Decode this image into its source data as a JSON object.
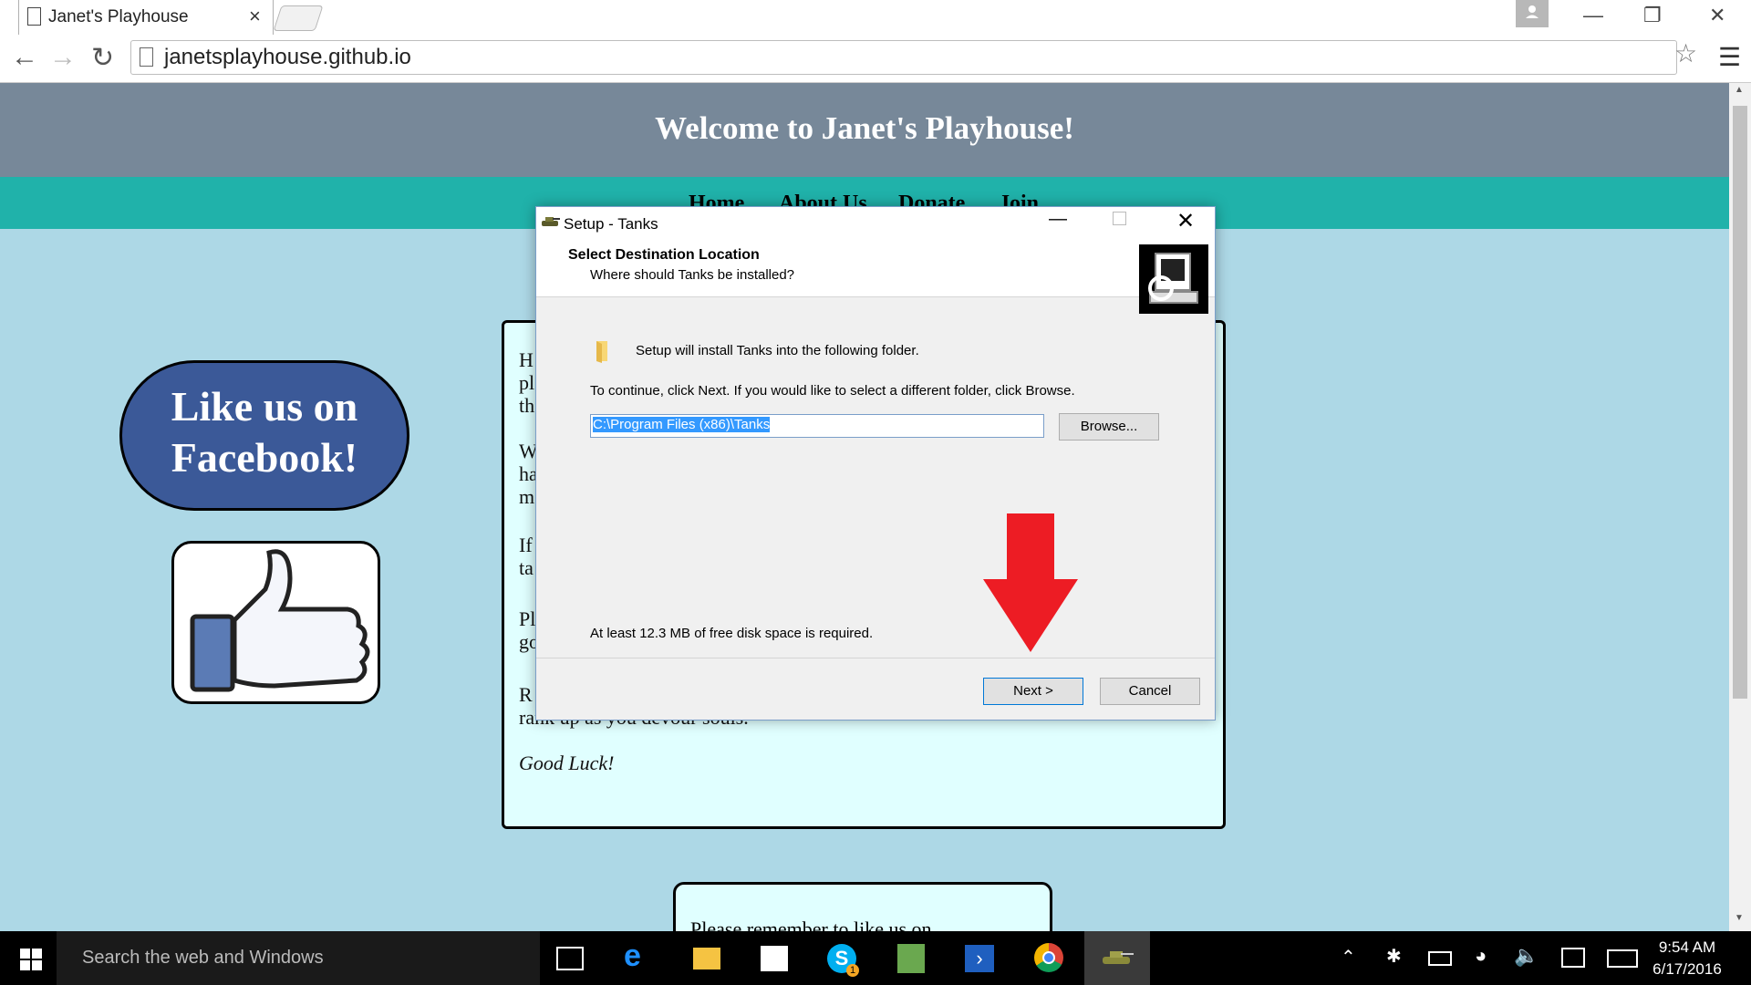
{
  "browser": {
    "tab_title": "Janet's Playhouse",
    "tab_close": "×",
    "url": "janetsplayhouse.github.io",
    "window_minimize": "—",
    "window_restore": "❐",
    "window_close": "✕"
  },
  "page": {
    "title": "Welcome to Janet's Playhouse!",
    "nav": [
      "Home",
      "About Us",
      "Donate",
      "Join"
    ],
    "facebook_cta_line1": "Like us on",
    "facebook_cta_line2": "Facebook!",
    "content_left_fragments": [
      "H",
      "pl",
      "th",
      "W",
      "ha",
      "m",
      "If",
      "ta",
      "Pl",
      "go",
      "R"
    ],
    "content_line_rank": "rank up as you devour souls.",
    "content_good_luck": "Good Luck!",
    "remember_text": "Please remember to like us on"
  },
  "dialog": {
    "title": "Setup - Tanks",
    "heading": "Select Destination Location",
    "subheading": "Where should Tanks be installed?",
    "install_text": "Setup will install Tanks into the following folder.",
    "continue_text": "To continue, click Next. If you would like to select a different folder, click Browse.",
    "path_value": "C:\\Program Files (x86)\\Tanks",
    "browse_label": "Browse...",
    "disk_space_text": "At least 12.3 MB of free disk space is required.",
    "next_label": "Next >",
    "cancel_label": "Cancel"
  },
  "taskbar": {
    "search_placeholder": "Search the web and Windows",
    "time": "9:54 AM",
    "date": "6/17/2016",
    "skype_badge": "1"
  },
  "colors": {
    "hero": "#778899",
    "navbar": "#20b2aa",
    "page_bg": "#add8e6",
    "facebook": "#3b5998",
    "arrow": "#ed1c24"
  }
}
